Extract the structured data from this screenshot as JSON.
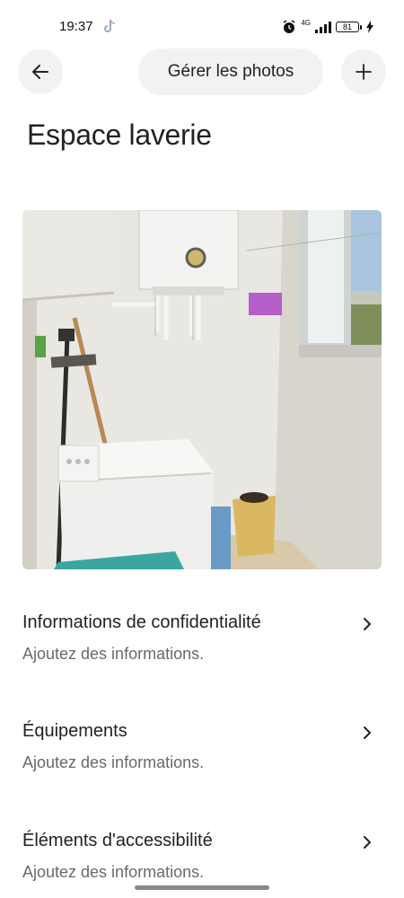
{
  "status_bar": {
    "time": "19:37",
    "network": "4G",
    "battery": "81"
  },
  "header": {
    "back_icon": "arrow-left-icon",
    "manage_label": "Gérer les photos",
    "add_icon": "plus-icon"
  },
  "page": {
    "title": "Espace laverie"
  },
  "items": [
    {
      "title": "Informations de confidentialité",
      "subtitle": "Ajoutez des informations."
    },
    {
      "title": "Équipements",
      "subtitle": "Ajoutez des informations."
    },
    {
      "title": "Éléments d'accessibilité",
      "subtitle": "Ajoutez des informations."
    }
  ],
  "colors": {
    "button_bg": "#f2f2f2",
    "text_primary": "#222222",
    "text_secondary": "#6a6a6a"
  }
}
